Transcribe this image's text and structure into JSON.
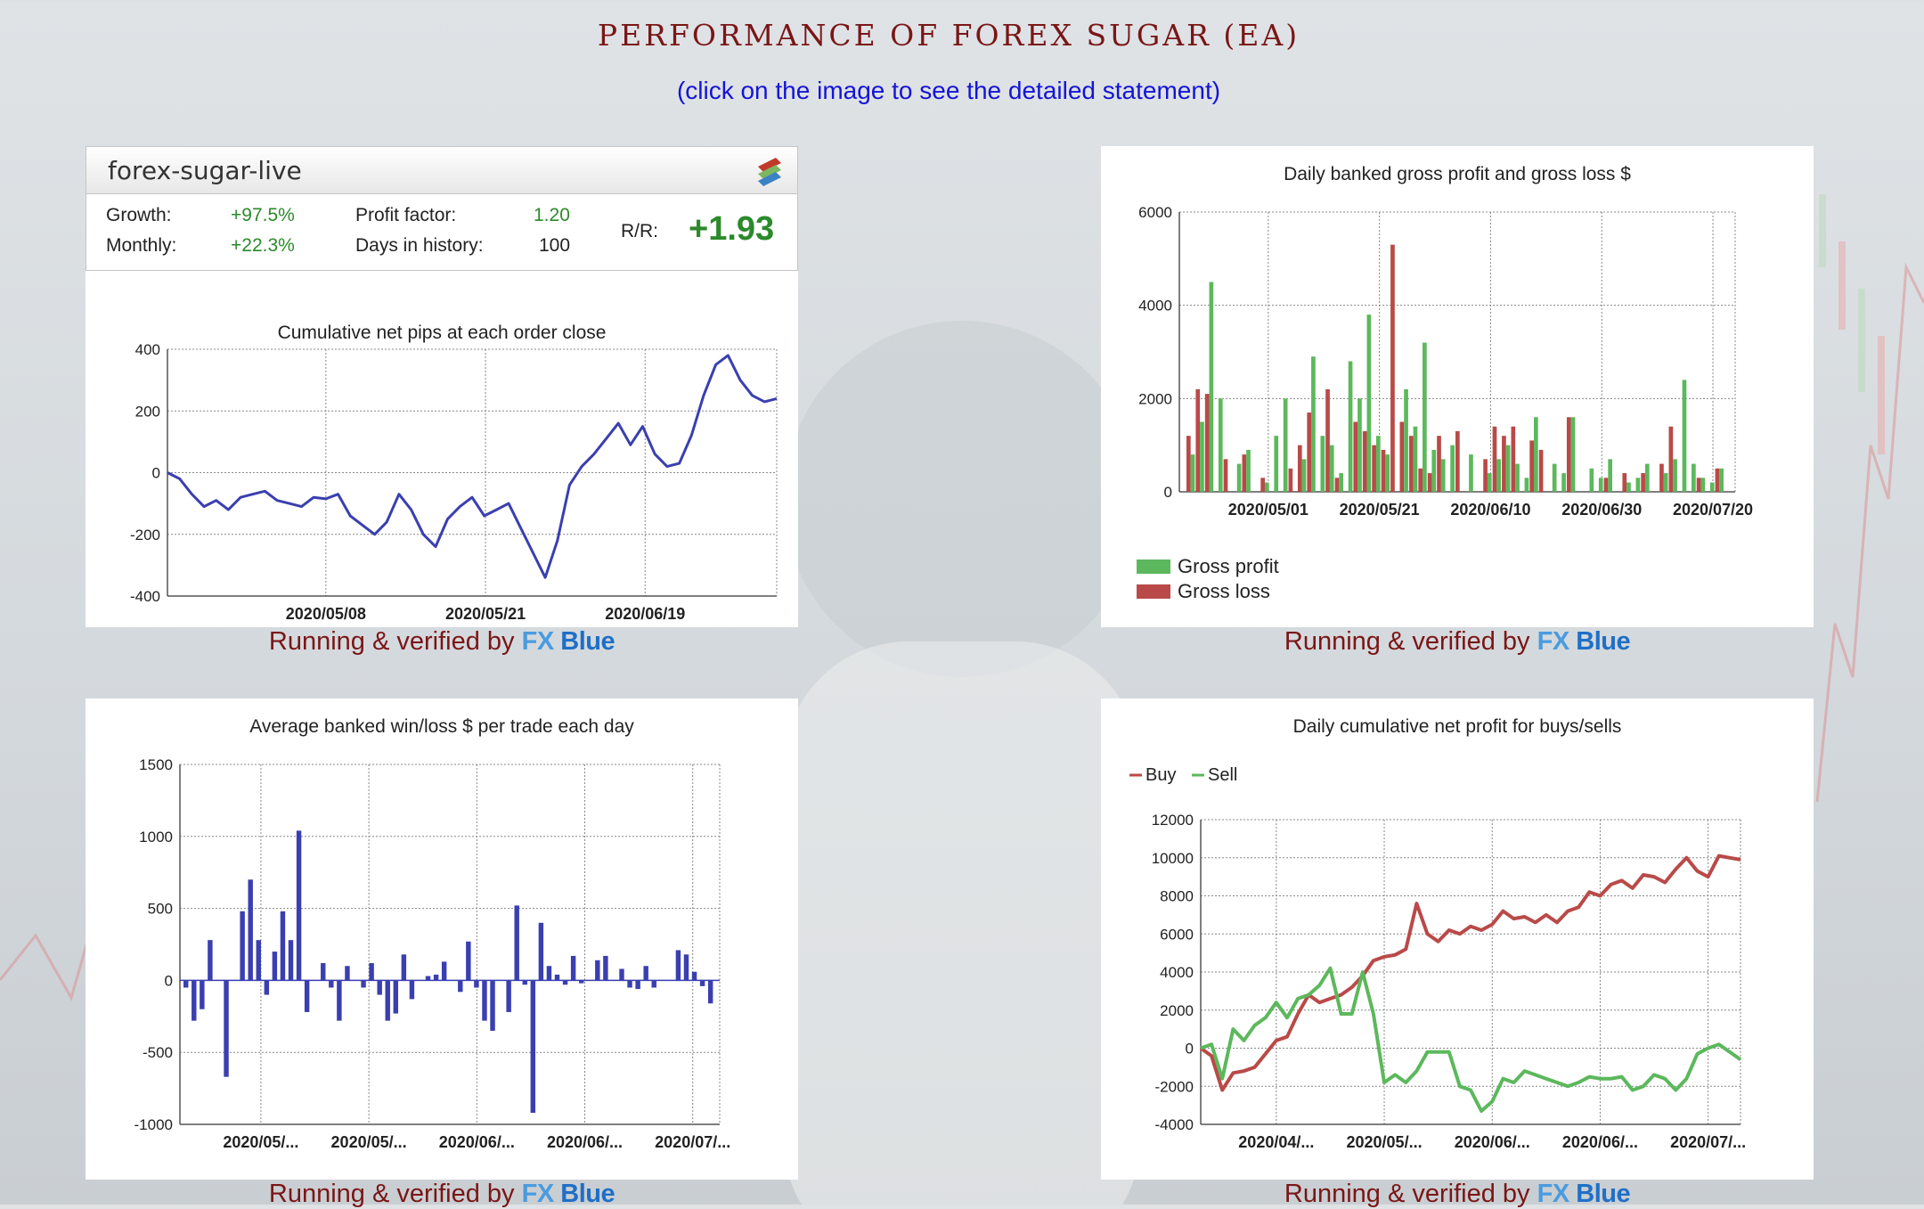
{
  "page": {
    "title": "PERFORMANCE OF FOREX SUGAR (EA)",
    "subtitle": "(click on the image to see the detailed statement)",
    "caption_text": "Running & verified by",
    "brand_fx": "FX",
    "brand_blue": "Blue"
  },
  "summary": {
    "account": "forex-sugar-live",
    "growth_label": "Growth:",
    "growth_value": "+97.5%",
    "monthly_label": "Monthly:",
    "monthly_value": "+22.3%",
    "pf_label": "Profit factor:",
    "pf_value": "1.20",
    "days_label": "Days in history:",
    "days_value": "100",
    "rr_label": "R/R:",
    "rr_value": "+1.93"
  },
  "chart_data": [
    {
      "type": "line",
      "title": "Cumulative net pips at each order close",
      "xlabel": "",
      "ylabel": "",
      "x_ticks": [
        "2020/05/08",
        "2020/05/21",
        "2020/06/19"
      ],
      "ylim": [
        -400,
        400
      ],
      "y_ticks": [
        400,
        200,
        0,
        -200,
        -400
      ],
      "grid": true,
      "color": "#3a3fb0",
      "x": [
        0,
        2,
        4,
        6,
        8,
        10,
        12,
        14,
        16,
        18,
        20,
        22,
        24,
        26,
        28,
        30,
        32,
        34,
        36,
        38,
        40,
        42,
        44,
        46,
        48,
        50,
        52,
        54,
        56,
        58,
        60,
        62,
        64,
        66,
        68,
        70,
        72,
        74,
        76,
        78,
        80,
        82,
        84,
        86,
        88,
        90,
        92,
        94,
        96,
        98,
        100
      ],
      "values": [
        0,
        -20,
        -70,
        -110,
        -90,
        -120,
        -80,
        -70,
        -60,
        -90,
        -100,
        -110,
        -80,
        -85,
        -70,
        -140,
        -170,
        -200,
        -160,
        -70,
        -120,
        -200,
        -240,
        -150,
        -110,
        -80,
        -140,
        -120,
        -100,
        -180,
        -260,
        -340,
        -220,
        -40,
        20,
        60,
        110,
        160,
        90,
        150,
        60,
        20,
        30,
        120,
        250,
        350,
        380,
        300,
        250,
        230,
        240
      ]
    },
    {
      "type": "bar",
      "title": "Daily banked gross profit and gross loss $",
      "xlabel": "",
      "ylabel": "",
      "x_ticks": [
        "2020/05/01",
        "2020/05/21",
        "2020/06/10",
        "2020/06/30",
        "2020/07/20"
      ],
      "ylim": [
        0,
        6000
      ],
      "y_ticks": [
        6000,
        4000,
        2000,
        0
      ],
      "legend": "bottom-left",
      "series": [
        {
          "name": "Gross profit",
          "color": "#5cb85c",
          "values": [
            800,
            1500,
            4500,
            2000,
            0,
            600,
            900,
            0,
            200,
            1200,
            2000,
            0,
            700,
            2900,
            1200,
            1000,
            400,
            2800,
            2000,
            3800,
            1200,
            800,
            0,
            2200,
            1400,
            3200,
            900,
            700,
            1000,
            0,
            800,
            0,
            400,
            700,
            1000,
            600,
            300,
            1600,
            0,
            600,
            400,
            1600,
            0,
            500,
            300,
            700,
            0,
            200,
            300,
            600,
            0,
            400,
            700,
            2400,
            600,
            300,
            200,
            500
          ]
        },
        {
          "name": "Gross loss",
          "color": "#b94a48",
          "values": [
            1200,
            2200,
            2100,
            0,
            700,
            0,
            800,
            0,
            300,
            0,
            0,
            500,
            1000,
            1700,
            0,
            2200,
            300,
            0,
            1500,
            1300,
            1000,
            900,
            5300,
            1500,
            1200,
            500,
            400,
            1200,
            0,
            1300,
            0,
            0,
            700,
            1400,
            1200,
            1400,
            0,
            1100,
            900,
            0,
            0,
            1600,
            0,
            0,
            0,
            300,
            0,
            400,
            0,
            400,
            0,
            600,
            1400,
            0,
            0,
            300,
            0,
            500
          ]
        }
      ]
    },
    {
      "type": "bar",
      "title": "Average banked win/loss $ per trade each day",
      "xlabel": "",
      "ylabel": "",
      "x_ticks": [
        "2020/05/...",
        "2020/05/...",
        "2020/06/...",
        "2020/06/...",
        "2020/07/..."
      ],
      "ylim": [
        -1000,
        1500
      ],
      "y_ticks": [
        1500,
        1000,
        500,
        0,
        -500,
        -1000
      ],
      "grid": true,
      "color": "#3a3fb0",
      "values": [
        -50,
        -280,
        -200,
        280,
        0,
        -670,
        0,
        480,
        700,
        280,
        -100,
        200,
        480,
        280,
        1040,
        -220,
        0,
        120,
        -50,
        -280,
        100,
        0,
        -50,
        120,
        -100,
        -280,
        -230,
        180,
        -130,
        0,
        30,
        40,
        130,
        0,
        -80,
        270,
        -50,
        -280,
        -350,
        0,
        -220,
        520,
        -30,
        -920,
        400,
        100,
        40,
        -30,
        170,
        -20,
        0,
        140,
        170,
        0,
        80,
        -50,
        -60,
        100,
        -50,
        0,
        0,
        210,
        180,
        60,
        -40,
        -160
      ]
    },
    {
      "type": "line",
      "title": "Daily cumulative net profit for buys/sells",
      "xlabel": "",
      "ylabel": "",
      "x_ticks": [
        "2020/04/...",
        "2020/05/...",
        "2020/06/...",
        "2020/06/...",
        "2020/07/..."
      ],
      "ylim": [
        -4000,
        12000
      ],
      "y_ticks": [
        12000,
        10000,
        8000,
        6000,
        4000,
        2000,
        0,
        -2000,
        -4000
      ],
      "legend": "top-left",
      "x": [
        0,
        2,
        4,
        6,
        8,
        10,
        12,
        14,
        16,
        18,
        20,
        22,
        24,
        26,
        28,
        30,
        32,
        34,
        36,
        38,
        40,
        42,
        44,
        46,
        48,
        50,
        52,
        54,
        56,
        58,
        60,
        62,
        64,
        66,
        68,
        70,
        72,
        74,
        76,
        78,
        80,
        82,
        84,
        86,
        88,
        90,
        92,
        94,
        96,
        98,
        100
      ],
      "series": [
        {
          "name": "Buy",
          "color": "#b94a48",
          "values": [
            0,
            -400,
            -2200,
            -1300,
            -1200,
            -1000,
            -300,
            400,
            600,
            1800,
            2800,
            2400,
            2600,
            2800,
            3200,
            3800,
            4600,
            4800,
            4900,
            5200,
            7600,
            6000,
            5600,
            6200,
            6000,
            6400,
            6200,
            6500,
            7200,
            6800,
            6900,
            6600,
            7000,
            6600,
            7200,
            7400,
            8200,
            8000,
            8600,
            8800,
            8400,
            9100,
            9000,
            8700,
            9400,
            10000,
            9300,
            9000,
            10100,
            10000,
            9900
          ]
        },
        {
          "name": "Sell",
          "color": "#5cb85c",
          "values": [
            0,
            200,
            -1600,
            1000,
            400,
            1200,
            1600,
            2400,
            1600,
            2600,
            2800,
            3300,
            4200,
            1800,
            1800,
            4000,
            1800,
            -1800,
            -1400,
            -1800,
            -1200,
            -200,
            -200,
            -200,
            -2000,
            -2200,
            -3300,
            -2800,
            -1600,
            -1800,
            -1200,
            -1400,
            -1600,
            -1800,
            -2000,
            -1800,
            -1500,
            -1600,
            -1600,
            -1500,
            -2200,
            -2000,
            -1400,
            -1600,
            -2200,
            -1600,
            -300,
            0,
            200,
            -200,
            -600
          ]
        }
      ]
    }
  ]
}
